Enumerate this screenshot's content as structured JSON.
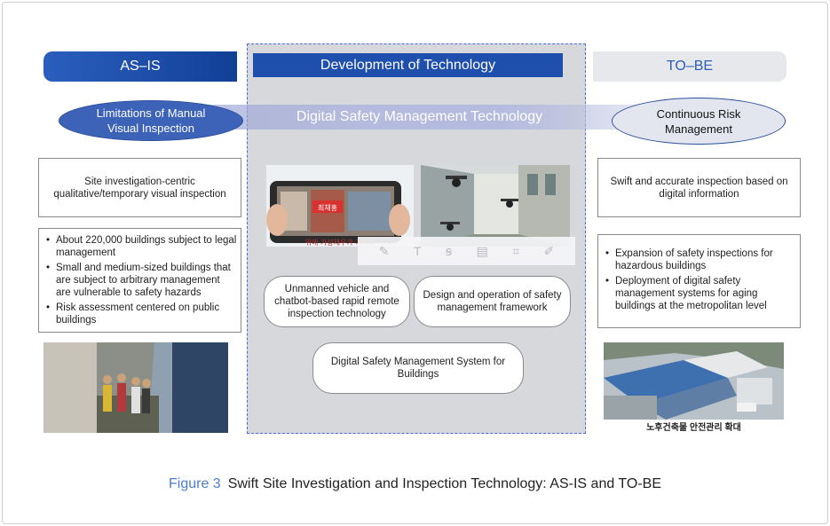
{
  "headers": {
    "as_is": "AS–IS",
    "development": "Development of Technology",
    "to_be": "TO–BE"
  },
  "band": {
    "title": "Digital Safety Management Technology"
  },
  "left": {
    "ellipse_line1": "Limitations of Manual",
    "ellipse_line2": "Visual Inspection",
    "summary": "Site investigation-centric qualitative/temporary visual inspection",
    "bullets": [
      "About 220,000 buildings subject to legal management",
      " Small and medium-sized buildings that are subject to arbitrary management are vulnerable to safety hazards",
      "Risk assessment centered on public buildings"
    ]
  },
  "center": {
    "tablet_overlay_text": "최채홍",
    "tablet_caption": "위에 가상채우가 가시화",
    "pills": [
      "Unmanned vehicle and chatbot-based rapid remote inspection technology",
      "Design and operation of safety management framework",
      "Digital Safety Management System for Buildings"
    ]
  },
  "right": {
    "ellipse_line1": "Continuous Risk",
    "ellipse_line2": "Management",
    "summary": "Swift and accurate inspection based on digital information",
    "bullets": [
      " Expansion of safety inspections for hazardous buildings",
      "Deployment of digital safety management systems for aging buildings at the metropolitan level"
    ],
    "photo_caption": "노후건축물 안전관리 확대"
  },
  "caption": {
    "label": "Figure 3",
    "text": "Swift Site Investigation and Inspection Technology: AS-IS and TO-BE"
  },
  "colors": {
    "primary_blue": "#1f4fad",
    "ellipse_blue": "#3c63b8",
    "figure_label": "#4b7bd0",
    "panel_gray": "#d6d8dc"
  },
  "icons": [
    "pen-icon",
    "text-icon",
    "strikethrough-icon",
    "image-icon",
    "crop-icon",
    "note-icon"
  ]
}
